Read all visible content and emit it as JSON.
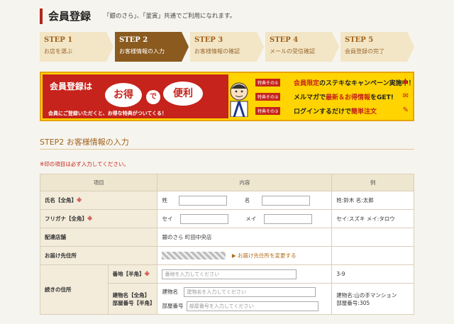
{
  "header": {
    "title": "会員登録",
    "subtitle": "「銀のさら」、「釜寅」共通でご利用になれます。"
  },
  "steps": [
    {
      "label1": "STEP 1",
      "label2": "お店を選ぶ",
      "active": false
    },
    {
      "label1": "STEP 2",
      "label2": "お客様情報の入力",
      "active": true
    },
    {
      "label1": "STEP 3",
      "label2": "お客様情報の確認",
      "active": false
    },
    {
      "label1": "STEP 4",
      "label2": "メールの受信確認",
      "active": false
    },
    {
      "label1": "STEP 5",
      "label2": "会員登録の完了",
      "active": false
    }
  ],
  "banner": {
    "head": "会員登録は",
    "otoku": "お得",
    "de": "で",
    "benri": "便利",
    "foot": "会員にご登録いただくと、お得な特典がついてくる！",
    "perks": [
      {
        "tag": "特典その①",
        "text_pre": "",
        "em": "会員限定",
        "text_post": "のステキなキャンペーン実施中！"
      },
      {
        "tag": "特典その②",
        "text_pre": "メルマガで",
        "em": "最新＆お得情報",
        "text_post": "をGET!"
      },
      {
        "tag": "特典その③",
        "text_pre": "ログインするだけで",
        "em": "簡単注文",
        "text_post": ""
      }
    ]
  },
  "section": {
    "title": "STEP2 お客様情報の入力",
    "required_note": "※印の項目は必ず入力してください。"
  },
  "table": {
    "headers": {
      "item": "項目",
      "content": "内容",
      "example": "例"
    },
    "name": {
      "label": "氏名【全角】",
      "req": "※",
      "sei": "姓",
      "mei": "名",
      "example": "姓:鈴木 名:太郎"
    },
    "kana": {
      "label": "フリガナ【全角】",
      "req": "※",
      "sei": "セイ",
      "mei": "メイ",
      "example": "セイ:スズキ メイ:タロウ"
    },
    "store": {
      "label": "配達店舗",
      "value": "銀のさら 町田中央店"
    },
    "delivery": {
      "label": "お届け先住所",
      "link": "▶ お届け先住所を変更する"
    },
    "address": {
      "label": "続きの住所",
      "banchi_label": "番地【半角】",
      "banchi_req": "※",
      "banchi_placeholder": "番地を入力してください",
      "banchi_example": "3-9",
      "bldg_label": "建物名【全角】部屋番号【半角】",
      "bldg_name_label": "建物名",
      "bldg_name_placeholder": "建物名を入力してください",
      "room_label": "部屋番号",
      "room_placeholder": "部屋番号を入力してください",
      "bldg_example_1": "建物名:山の手マンション",
      "bldg_example_2": "部屋番号:305"
    }
  },
  "colors": {
    "accent": "#c5231b",
    "step_active": "#8a5a1e",
    "step_inactive": "#f3e6c6"
  }
}
